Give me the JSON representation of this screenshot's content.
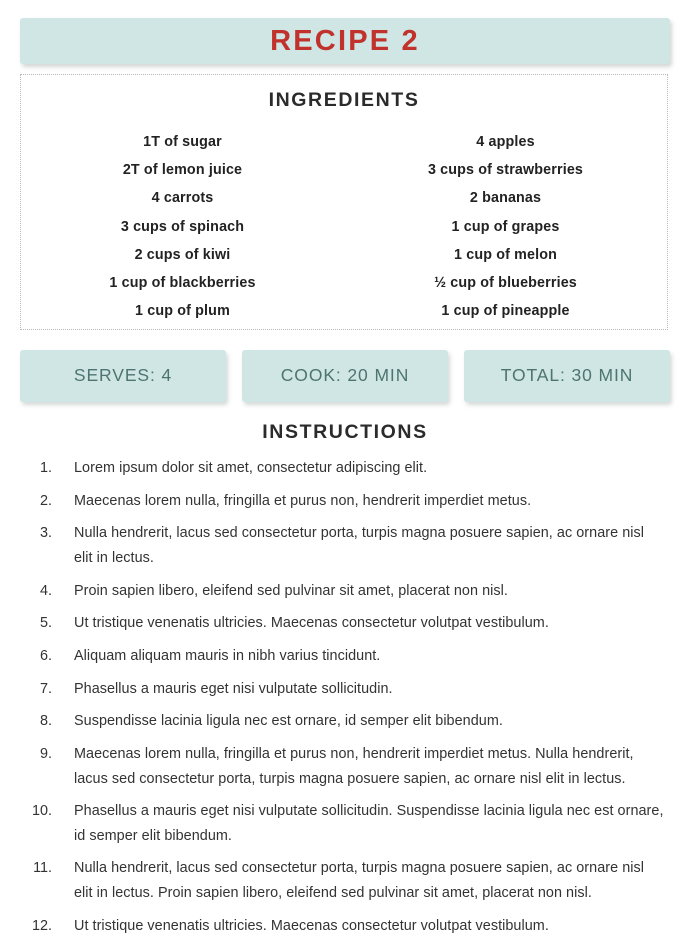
{
  "title": {
    "text": "RECIPE 2",
    "accent_color": "#c0322b",
    "banner_color": "#cfe6e5"
  },
  "ingredients": {
    "heading": "INGREDIENTS",
    "column_left": [
      "1T of sugar",
      "2T of lemon juice",
      "4 carrots",
      "3 cups of spinach",
      "2 cups of kiwi",
      "1 cup of blackberries",
      "1 cup of plum"
    ],
    "column_right": [
      "4 apples",
      "3 cups of strawberries",
      "2 bananas",
      "1 cup of grapes",
      "1 cup of melon",
      "½ cup of blueberries",
      "1 cup of pineapple"
    ]
  },
  "info_boxes": [
    {
      "label": "SERVES: 4"
    },
    {
      "label": "COOK: 20 MIN"
    },
    {
      "label": "TOTAL: 30 MIN"
    }
  ],
  "instructions": {
    "heading": "INSTRUCTIONS",
    "items": [
      {
        "number": "1.",
        "text": "Lorem ipsum dolor sit amet, consectetur adipiscing elit."
      },
      {
        "number": "2.",
        "text": "Maecenas lorem nulla, fringilla et purus non, hendrerit imperdiet metus."
      },
      {
        "number": "3.",
        "text": "Nulla hendrerit, lacus sed consectetur porta, turpis magna posuere sapien, ac ornare nisl elit in lectus."
      },
      {
        "number": "4.",
        "text": "Proin sapien libero, eleifend sed pulvinar sit amet, placerat non nisl."
      },
      {
        "number": "5.",
        "text": "Ut tristique venenatis ultricies. Maecenas consectetur volutpat vestibulum."
      },
      {
        "number": "6.",
        "text": "Aliquam aliquam mauris in nibh varius tincidunt."
      },
      {
        "number": "7.",
        "text": "Phasellus a mauris eget nisi vulputate sollicitudin."
      },
      {
        "number": "8.",
        "text": "Suspendisse lacinia ligula nec est ornare, id semper elit bibendum."
      },
      {
        "number": "9.",
        "text": "Maecenas lorem nulla, fringilla et purus non, hendrerit imperdiet metus. Nulla hendrerit, lacus sed consectetur porta, turpis magna posuere sapien, ac ornare nisl elit in lectus."
      },
      {
        "number": "10.",
        "text": "Phasellus a mauris eget nisi vulputate sollicitudin. Suspendisse lacinia ligula nec est ornare, id semper elit bibendum."
      },
      {
        "number": "11.",
        "text": "Nulla hendrerit, lacus sed consectetur porta, turpis magna posuere sapien, ac ornare nisl elit in lectus. Proin sapien libero, eleifend sed pulvinar sit amet, placerat non nisl."
      },
      {
        "number": "12.",
        "text": "Ut tristique venenatis ultricies. Maecenas consectetur volutpat vestibulum."
      }
    ]
  }
}
